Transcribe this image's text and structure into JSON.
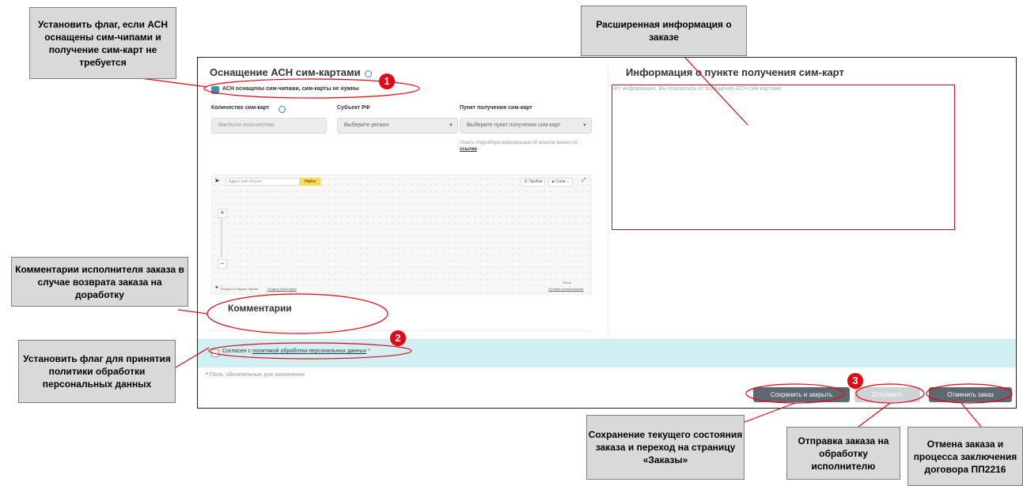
{
  "form": {
    "section_title": "Оснащение АСН сим-картами",
    "sim_checkbox_label": "АСН оснащены сим-чипами, сим-карты не нужны",
    "qty_label": "Количество сим-карт",
    "qty_placeholder": "Введите количество",
    "region_label": "Субъект РФ",
    "region_placeholder": "Выберите регион",
    "pickup_label": "Пункт получения сим-карт",
    "pickup_placeholder": "Выберите пункт получения сим-карт",
    "hint_text": "Узнать подробную информацию об агентах можно по",
    "hint_link": "ссылке",
    "comments_title": "Комментарии",
    "consent_prefix": "Согласен с",
    "consent_link": "политикой обработки персональных данных",
    "required_note": "Поля, обязательные для заполнения",
    "asterisk": "*"
  },
  "map": {
    "search_placeholder": "Адрес или объект",
    "find_button": "Найти",
    "traffic": "Пробки",
    "layers": "Слои",
    "open_link": "Открыть в Яндекс Картах",
    "create_link": "Создать свою карту",
    "scale": "100 м",
    "terms": "Условия использования",
    "zoom_in": "+",
    "zoom_out": "−"
  },
  "info_panel": {
    "title": "Информация о пункте получения сим-карт",
    "message": "Нет информации. Вы отказались от оснащения АСН сим-картами"
  },
  "buttons": {
    "save_close": "Сохранить и закрыть",
    "send": "Отправить",
    "cancel": "Отменить заказ"
  },
  "annotations": {
    "flag_sim": "Установить флаг, если АСН оснащены сим-чипами и получение сим-карт не требуется",
    "extended_info": "Расширенная информация о заказе",
    "comments": "Комментарии исполнителя заказа в случае возврата заказа на доработку",
    "flag_policy": "Установить флаг для принятия политики обработки персональных данных",
    "save_desc": "Сохранение текущего состояния заказа и переход на страницу «Заказы»",
    "send_desc": "Отправка заказа на обработку исполнителю",
    "cancel_desc": "Отмена заказа и процесса заключения договора ПП2216",
    "badge1": "1",
    "badge2": "2",
    "badge3": "3"
  },
  "colors": {
    "annotation_red": "#e30613",
    "band_cyan": "#d2f0f3",
    "button_dark": "#5e6870",
    "checkbox_blue": "#3a8fb8"
  }
}
